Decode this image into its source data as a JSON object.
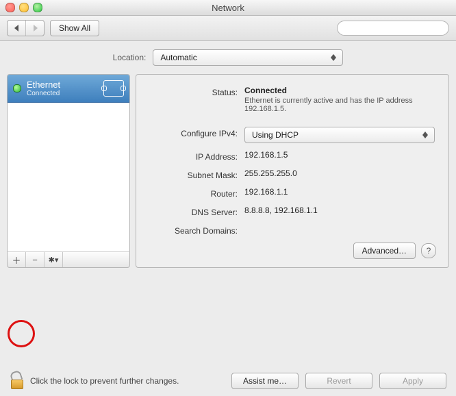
{
  "window": {
    "title": "Network"
  },
  "toolbar": {
    "show_all": "Show All",
    "search_placeholder": ""
  },
  "location": {
    "label": "Location:",
    "value": "Automatic"
  },
  "sidebar": {
    "services": [
      {
        "name": "Ethernet",
        "status": "Connected",
        "icon": "ethernet-icon",
        "status_color": "#2fb83a"
      }
    ]
  },
  "panel": {
    "status": {
      "label": "Status:",
      "value": "Connected",
      "description": "Ethernet is currently active and has the IP address 192.168.1.5."
    },
    "configure_ipv4": {
      "label": "Configure IPv4:",
      "value": "Using DHCP"
    },
    "ip_address": {
      "label": "IP Address:",
      "value": "192.168.1.5"
    },
    "subnet_mask": {
      "label": "Subnet Mask:",
      "value": "255.255.255.0"
    },
    "router": {
      "label": "Router:",
      "value": "192.168.1.1"
    },
    "dns_server": {
      "label": "DNS Server:",
      "value": "8.8.8.8, 192.168.1.1"
    },
    "search_domains": {
      "label": "Search Domains:",
      "value": ""
    },
    "advanced_button": "Advanced…"
  },
  "footer": {
    "lock_text": "Click the lock to prevent further changes.",
    "assist": "Assist me…",
    "revert": "Revert",
    "apply": "Apply"
  }
}
